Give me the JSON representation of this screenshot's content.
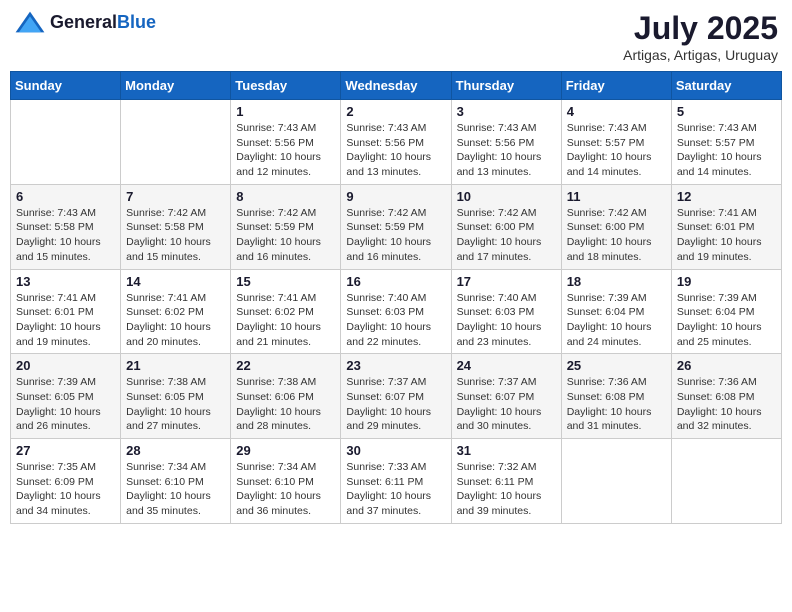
{
  "logo": {
    "general": "General",
    "blue": "Blue"
  },
  "header": {
    "month_year": "July 2025",
    "location": "Artigas, Artigas, Uruguay"
  },
  "weekdays": [
    "Sunday",
    "Monday",
    "Tuesday",
    "Wednesday",
    "Thursday",
    "Friday",
    "Saturday"
  ],
  "weeks": [
    [
      {
        "day": "",
        "info": ""
      },
      {
        "day": "",
        "info": ""
      },
      {
        "day": "1",
        "info": "Sunrise: 7:43 AM\nSunset: 5:56 PM\nDaylight: 10 hours and 12 minutes."
      },
      {
        "day": "2",
        "info": "Sunrise: 7:43 AM\nSunset: 5:56 PM\nDaylight: 10 hours and 13 minutes."
      },
      {
        "day": "3",
        "info": "Sunrise: 7:43 AM\nSunset: 5:56 PM\nDaylight: 10 hours and 13 minutes."
      },
      {
        "day": "4",
        "info": "Sunrise: 7:43 AM\nSunset: 5:57 PM\nDaylight: 10 hours and 14 minutes."
      },
      {
        "day": "5",
        "info": "Sunrise: 7:43 AM\nSunset: 5:57 PM\nDaylight: 10 hours and 14 minutes."
      }
    ],
    [
      {
        "day": "6",
        "info": "Sunrise: 7:43 AM\nSunset: 5:58 PM\nDaylight: 10 hours and 15 minutes."
      },
      {
        "day": "7",
        "info": "Sunrise: 7:42 AM\nSunset: 5:58 PM\nDaylight: 10 hours and 15 minutes."
      },
      {
        "day": "8",
        "info": "Sunrise: 7:42 AM\nSunset: 5:59 PM\nDaylight: 10 hours and 16 minutes."
      },
      {
        "day": "9",
        "info": "Sunrise: 7:42 AM\nSunset: 5:59 PM\nDaylight: 10 hours and 16 minutes."
      },
      {
        "day": "10",
        "info": "Sunrise: 7:42 AM\nSunset: 6:00 PM\nDaylight: 10 hours and 17 minutes."
      },
      {
        "day": "11",
        "info": "Sunrise: 7:42 AM\nSunset: 6:00 PM\nDaylight: 10 hours and 18 minutes."
      },
      {
        "day": "12",
        "info": "Sunrise: 7:41 AM\nSunset: 6:01 PM\nDaylight: 10 hours and 19 minutes."
      }
    ],
    [
      {
        "day": "13",
        "info": "Sunrise: 7:41 AM\nSunset: 6:01 PM\nDaylight: 10 hours and 19 minutes."
      },
      {
        "day": "14",
        "info": "Sunrise: 7:41 AM\nSunset: 6:02 PM\nDaylight: 10 hours and 20 minutes."
      },
      {
        "day": "15",
        "info": "Sunrise: 7:41 AM\nSunset: 6:02 PM\nDaylight: 10 hours and 21 minutes."
      },
      {
        "day": "16",
        "info": "Sunrise: 7:40 AM\nSunset: 6:03 PM\nDaylight: 10 hours and 22 minutes."
      },
      {
        "day": "17",
        "info": "Sunrise: 7:40 AM\nSunset: 6:03 PM\nDaylight: 10 hours and 23 minutes."
      },
      {
        "day": "18",
        "info": "Sunrise: 7:39 AM\nSunset: 6:04 PM\nDaylight: 10 hours and 24 minutes."
      },
      {
        "day": "19",
        "info": "Sunrise: 7:39 AM\nSunset: 6:04 PM\nDaylight: 10 hours and 25 minutes."
      }
    ],
    [
      {
        "day": "20",
        "info": "Sunrise: 7:39 AM\nSunset: 6:05 PM\nDaylight: 10 hours and 26 minutes."
      },
      {
        "day": "21",
        "info": "Sunrise: 7:38 AM\nSunset: 6:05 PM\nDaylight: 10 hours and 27 minutes."
      },
      {
        "day": "22",
        "info": "Sunrise: 7:38 AM\nSunset: 6:06 PM\nDaylight: 10 hours and 28 minutes."
      },
      {
        "day": "23",
        "info": "Sunrise: 7:37 AM\nSunset: 6:07 PM\nDaylight: 10 hours and 29 minutes."
      },
      {
        "day": "24",
        "info": "Sunrise: 7:37 AM\nSunset: 6:07 PM\nDaylight: 10 hours and 30 minutes."
      },
      {
        "day": "25",
        "info": "Sunrise: 7:36 AM\nSunset: 6:08 PM\nDaylight: 10 hours and 31 minutes."
      },
      {
        "day": "26",
        "info": "Sunrise: 7:36 AM\nSunset: 6:08 PM\nDaylight: 10 hours and 32 minutes."
      }
    ],
    [
      {
        "day": "27",
        "info": "Sunrise: 7:35 AM\nSunset: 6:09 PM\nDaylight: 10 hours and 34 minutes."
      },
      {
        "day": "28",
        "info": "Sunrise: 7:34 AM\nSunset: 6:10 PM\nDaylight: 10 hours and 35 minutes."
      },
      {
        "day": "29",
        "info": "Sunrise: 7:34 AM\nSunset: 6:10 PM\nDaylight: 10 hours and 36 minutes."
      },
      {
        "day": "30",
        "info": "Sunrise: 7:33 AM\nSunset: 6:11 PM\nDaylight: 10 hours and 37 minutes."
      },
      {
        "day": "31",
        "info": "Sunrise: 7:32 AM\nSunset: 6:11 PM\nDaylight: 10 hours and 39 minutes."
      },
      {
        "day": "",
        "info": ""
      },
      {
        "day": "",
        "info": ""
      }
    ]
  ]
}
